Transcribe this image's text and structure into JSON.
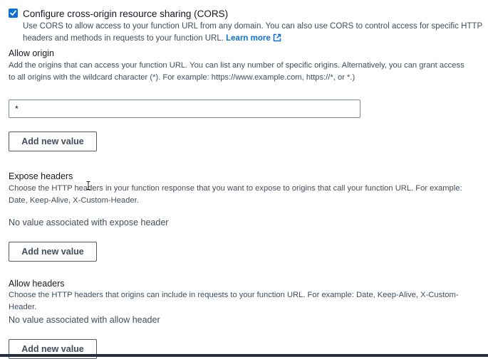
{
  "cors": {
    "checked": true,
    "title": "Configure cross-origin resource sharing (CORS)",
    "description": "Use CORS to allow access to your function URL from any domain. You can also use CORS to control access for specific HTTP headers and methods in requests to your function URL.",
    "learn_more": "Learn more"
  },
  "allow_origin": {
    "label": "Allow origin",
    "description": "Add the origins that can access your function URL. You can list any number of specific origins. Alternatively, you can grant access to all origins with the wildcard character (*). For example: https://www.example.com, https://*, or *.)",
    "value": "*",
    "add_button": "Add new value"
  },
  "expose_headers": {
    "label": "Expose headers",
    "description": "Choose the HTTP headers in your function response that you want to expose to origins that call your function URL. For example: Date, Keep-Alive, X-Custom-Header.",
    "empty_text": "No value associated with expose header",
    "add_button": "Add new value"
  },
  "allow_headers": {
    "label": "Allow headers",
    "description": "Choose the HTTP headers that origins can include in requests to your function URL. For example: Date, Keep-Alive, X-Custom-Header.",
    "empty_text": "No value associated with allow header",
    "add_button": "Add new value"
  },
  "icons": {
    "checkbox": "checkmark-icon",
    "external_link": "external-link-icon",
    "cursor": "text-cursor-icon"
  },
  "colors": {
    "accent": "#0972d3",
    "text": "#16191f",
    "secondary_text": "#414d5c",
    "border": "#7d8998"
  }
}
